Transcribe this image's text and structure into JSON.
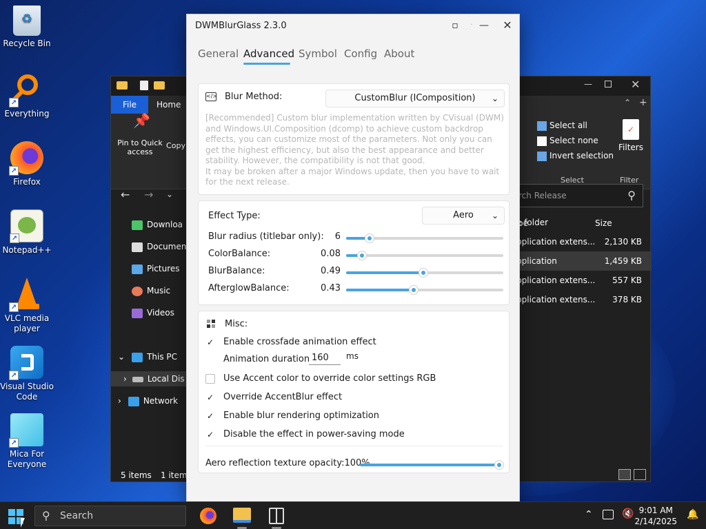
{
  "desktop": {
    "icons": [
      {
        "label": "Recycle Bin"
      },
      {
        "label": "Everything"
      },
      {
        "label": "Firefox"
      },
      {
        "label": "Notepad++"
      },
      {
        "label": "VLC media player"
      },
      {
        "label": "Visual Studio Code"
      },
      {
        "label": "Mica For Everyone"
      }
    ]
  },
  "explorer": {
    "file_tab": "File",
    "home_tab": "Home",
    "pin_label": "Pin to Quick access",
    "copy_label": "Copy",
    "select_all": "Select all",
    "select_none": "Select none",
    "invert_selection": "Invert selection",
    "select_group": "Select",
    "filters_label": "Filters",
    "filter_group": "Filter",
    "search_placeholder": "rch Release",
    "col_type": "pe",
    "col_size": "Size",
    "nav": [
      "Downloa",
      "Documen",
      "Pictures",
      "Music",
      "Videos"
    ],
    "this_pc": "This PC",
    "local_disk": "Local Dis",
    "network": "Network",
    "files": [
      {
        "type": "e folder",
        "size": ""
      },
      {
        "type": "pplication extens...",
        "size": "2,130 KB"
      },
      {
        "type": "pplication",
        "size": "1,459 KB"
      },
      {
        "type": "pplication extens...",
        "size": "557 KB"
      },
      {
        "type": "pplication extens...",
        "size": "378 KB"
      }
    ],
    "status_items": "5 items",
    "status_selected": "1 item"
  },
  "app": {
    "title": "DWMBlurGlass 2.3.0",
    "tabs": [
      {
        "label": "General"
      },
      {
        "label": "Advanced"
      },
      {
        "label": "Symbol"
      },
      {
        "label": "Config"
      },
      {
        "label": "About"
      }
    ],
    "active_tab": "Advanced",
    "blur_method": {
      "label": "Blur Method:",
      "value": "CustomBlur (IComposition)",
      "description": "[Recommended] Custom blur implementation written by CVisual (DWM) and Windows.UI.Composition (dcomp) to achieve custom backdrop effects, you can customize most of the parameters. Not only you can get the highest efficiency, but also the best appearance and better stability. However, the compatibility is not that good.\nIt may be broken after a major Windows update, then you have to wait for the next release."
    },
    "effect": {
      "label": "Effect Type:",
      "value": "Aero",
      "sliders": [
        {
          "label": "Blur radius (titlebar only):",
          "value": "6",
          "fraction": 0.15
        },
        {
          "label": "ColorBalance:",
          "value": "0.08",
          "fraction": 0.1
        },
        {
          "label": "BlurBalance:",
          "value": "0.49",
          "fraction": 0.49
        },
        {
          "label": "AfterglowBalance:",
          "value": "0.43",
          "fraction": 0.43
        }
      ]
    },
    "misc": {
      "label": "Misc:",
      "crossfade": {
        "label": "Enable crossfade animation effect",
        "checked": true
      },
      "anim_duration_label": "Animation duration:",
      "anim_duration_value": "160",
      "anim_unit": "ms",
      "accent_override": {
        "label": "Use Accent color to override color settings RGB",
        "checked": false
      },
      "accent_blur": {
        "label": "Override AccentBlur effect",
        "checked": true
      },
      "blur_opt": {
        "label": "Enable blur rendering optimization",
        "checked": true
      },
      "power_saving": {
        "label": "Disable the effect in power-saving mode",
        "checked": true
      },
      "reflection_label": "Aero reflection texture opacity:100%",
      "reflection_fraction": 1.0
    }
  },
  "taskbar": {
    "search_label": "Search",
    "time": "9:01 AM",
    "date": "2/14/2025"
  },
  "colors": {
    "accent": "#4aa3df",
    "explorer_file_tab": "#1a5fd6"
  }
}
